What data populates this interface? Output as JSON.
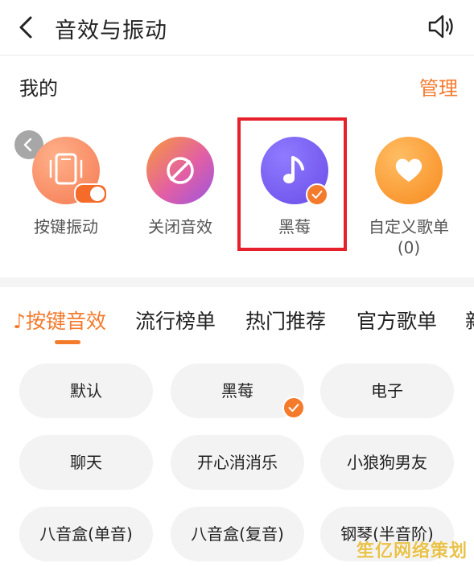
{
  "header": {
    "title": "音效与振动",
    "back_icon": "chevron-left-icon",
    "speaker_icon": "speaker-icon"
  },
  "mine": {
    "title": "我的",
    "manage_label": "管理"
  },
  "sounds": [
    {
      "label": "按键振动",
      "icon": "vibrate-phone-icon",
      "toggle_on": true
    },
    {
      "label": "关闭音效",
      "icon": "no-sound-icon"
    },
    {
      "label": "黑莓",
      "icon": "music-note-icon",
      "selected": true
    },
    {
      "label": "自定义歌单",
      "sub": "(0)",
      "icon": "heart-icon"
    }
  ],
  "tabs": [
    {
      "label": "♪按键音效",
      "active": true
    },
    {
      "label": "流行榜单"
    },
    {
      "label": "热门推荐"
    },
    {
      "label": "官方歌单"
    },
    {
      "label": "新"
    }
  ],
  "presets": [
    {
      "label": "默认"
    },
    {
      "label": "黑莓",
      "selected": true
    },
    {
      "label": "电子"
    },
    {
      "label": "聊天"
    },
    {
      "label": "开心消消乐"
    },
    {
      "label": "小狼狗男友"
    },
    {
      "label": "八音盒(单音)"
    },
    {
      "label": "八音盒(复音)"
    },
    {
      "label": "钢琴(半音阶)"
    }
  ],
  "watermark": "笙亿网络策划",
  "colors": {
    "accent": "#f47a2c",
    "highlight_box": "#e5202b"
  }
}
